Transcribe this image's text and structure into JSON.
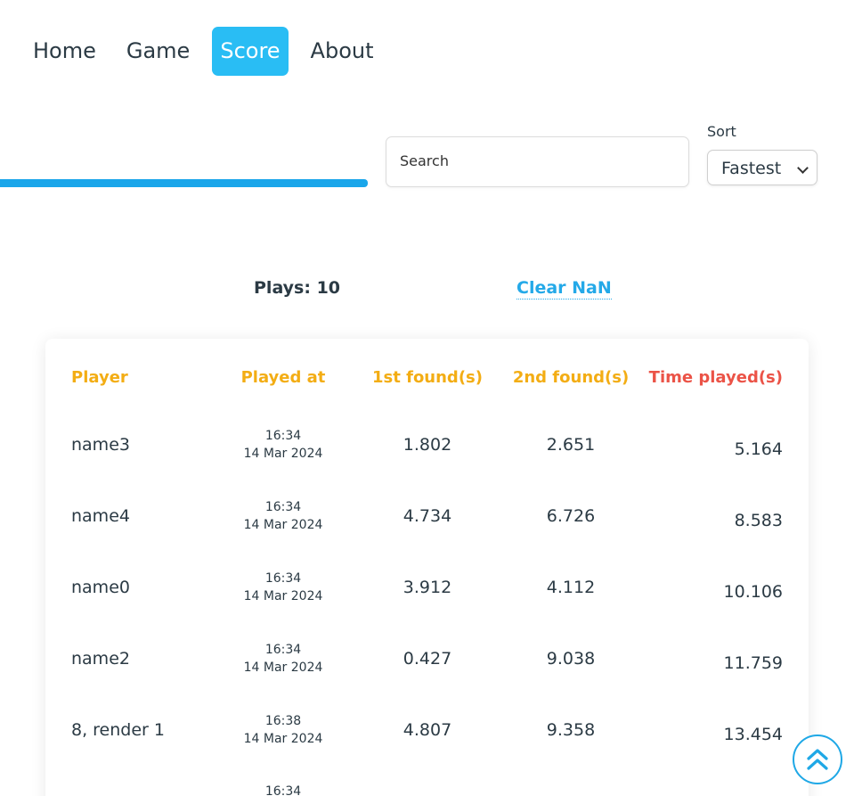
{
  "nav": {
    "items": [
      {
        "label": "Home",
        "active": false
      },
      {
        "label": "Game",
        "active": false
      },
      {
        "label": "Score",
        "active": true
      },
      {
        "label": "About",
        "active": false
      }
    ]
  },
  "toolbar": {
    "search_placeholder": "Search",
    "sort_label": "Sort",
    "sort_value": "Fastest"
  },
  "stats": {
    "plays": "Plays: 10",
    "clear_label": "Clear NaN"
  },
  "table": {
    "headers": {
      "player": "Player",
      "played_at": "Played at",
      "first": "1st found(s)",
      "second": "2nd found(s)",
      "time": "Time played(s)"
    },
    "rows": [
      {
        "player": "name3",
        "time_of_day": "16:34",
        "date": "14 Mar 2024",
        "first": "1.802",
        "second": "2.651",
        "total": "5.164"
      },
      {
        "player": "name4",
        "time_of_day": "16:34",
        "date": "14 Mar 2024",
        "first": "4.734",
        "second": "6.726",
        "total": "8.583"
      },
      {
        "player": "name0",
        "time_of_day": "16:34",
        "date": "14 Mar 2024",
        "first": "3.912",
        "second": "4.112",
        "total": "10.106"
      },
      {
        "player": "name2",
        "time_of_day": "16:34",
        "date": "14 Mar 2024",
        "first": "0.427",
        "second": "9.038",
        "total": "11.759"
      },
      {
        "player": "8, render 1",
        "time_of_day": "16:38",
        "date": "14 Mar 2024",
        "first": "4.807",
        "second": "9.358",
        "total": "13.454"
      },
      {
        "player": "",
        "time_of_day": "16:34",
        "date": "",
        "first": "",
        "second": "",
        "total": ""
      }
    ]
  },
  "colors": {
    "accent": "#29bdf4",
    "header_orange": "#f3ad14",
    "header_red": "#eb5347"
  },
  "icons": {
    "back_to_top": "double-chevron-up-icon"
  }
}
